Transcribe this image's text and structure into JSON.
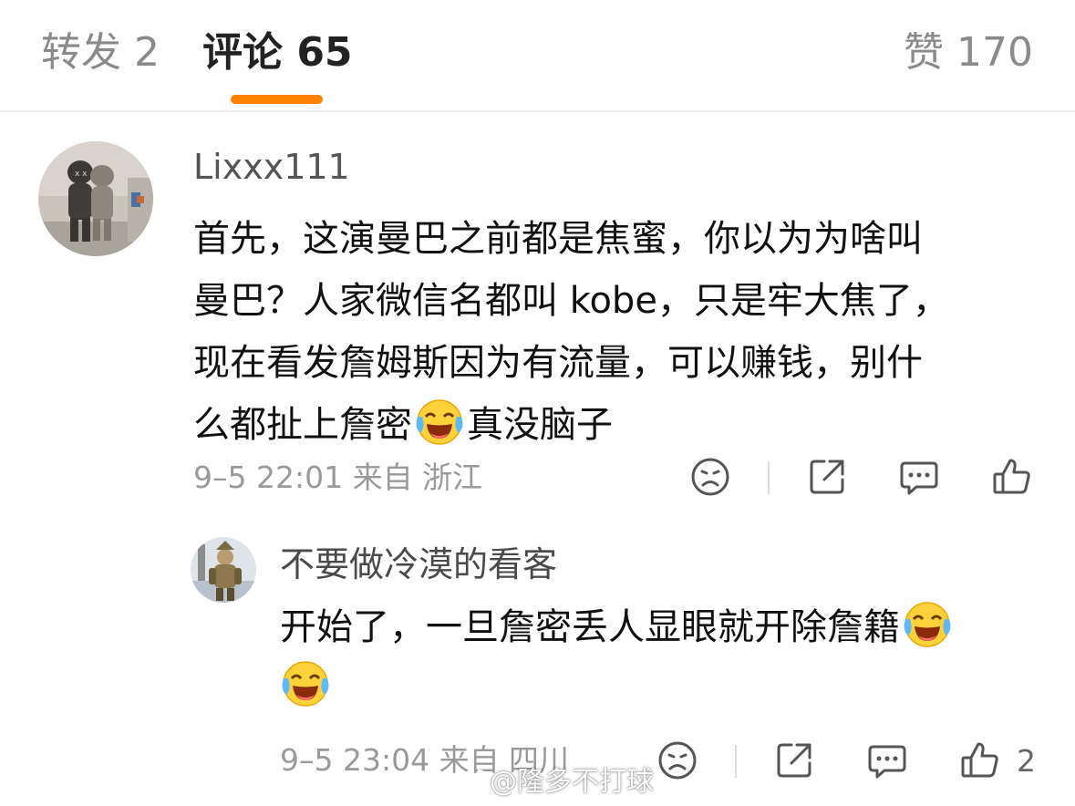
{
  "tabs": {
    "repost": "转发 2",
    "comment": "评论 65",
    "like": "赞 170",
    "accent": "#ff8200"
  },
  "comment": {
    "username": "Lixxx111",
    "lines": [
      "首先，这演曼巴之前都是焦蜜，你以为为啥叫",
      "曼巴？人家微信名都叫 kobe，只是牢大焦了，",
      "现在看发詹姆斯因为有流量，可以赚钱，别什",
      "么都扯上詹密"
    ],
    "line4_tail": "真没脑子",
    "emoji": "laughing-crying-emoji",
    "meta": "9–5 22:01  来自 浙江"
  },
  "reply": {
    "username": "不要做冷漠的看客",
    "line1": "开始了，一旦詹密丢人显眼就开除詹籍",
    "emoji": "laughing-crying-emoji",
    "meta": "9–5 23:04  来自 四川",
    "like_count": "2"
  },
  "icons": {
    "dislike": "frown-face-icon",
    "share": "share-icon",
    "reply": "comment-bubble-icon",
    "like": "thumbs-up-icon"
  },
  "watermark": "@隆多不打球"
}
